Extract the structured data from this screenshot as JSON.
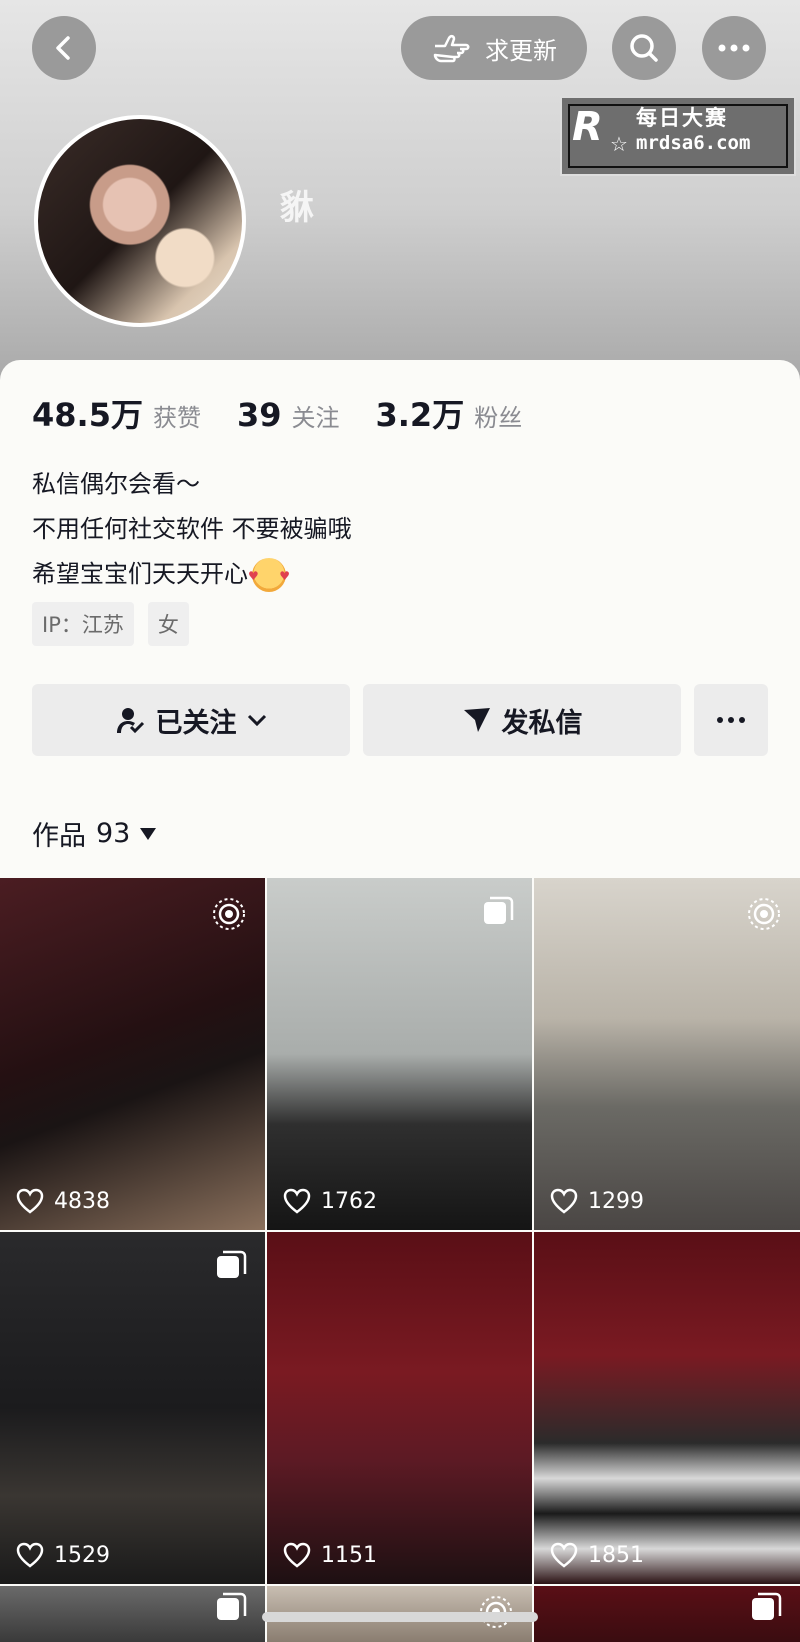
{
  "header": {
    "update_label": "求更新",
    "username": "貅",
    "watermark_title": "每日大赛",
    "watermark_url": "mrdsa6.com"
  },
  "stats": [
    {
      "value": "48.5万",
      "label": "获赞"
    },
    {
      "value": "39",
      "label": "关注"
    },
    {
      "value": "3.2万",
      "label": "粉丝"
    }
  ],
  "bio": {
    "line1": "私信偶尔会看～",
    "line2": "不用任何社交软件 不要被骗哦",
    "line3": "希望宝宝们天天开心"
  },
  "tags": {
    "ip": "IP：江苏",
    "gender": "女"
  },
  "actions": {
    "follow": "已关注",
    "message": "发私信"
  },
  "works": {
    "label": "作品",
    "count": "93"
  },
  "posts": [
    {
      "likes": "4838",
      "icon": "live-icon"
    },
    {
      "likes": "1762",
      "icon": "multi-image-icon"
    },
    {
      "likes": "1299",
      "icon": "live-icon"
    },
    {
      "likes": "1529",
      "icon": "multi-image-icon"
    },
    {
      "likes": "1151",
      "icon": "none"
    },
    {
      "likes": "1851",
      "icon": "none"
    }
  ]
}
